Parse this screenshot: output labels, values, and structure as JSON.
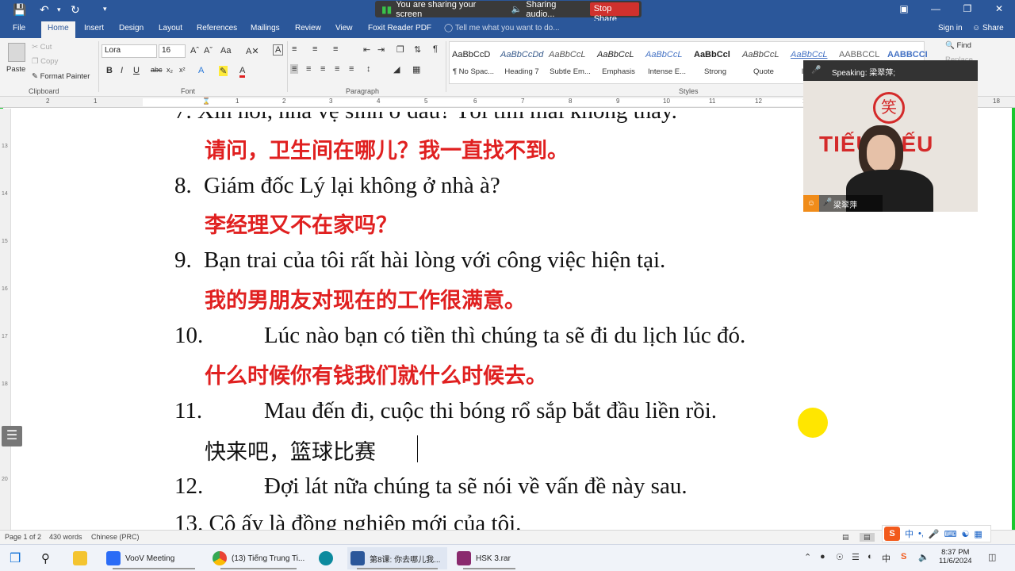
{
  "screen_share": {
    "status": "You are sharing your screen",
    "audio": "Sharing audio...",
    "stop": "Stop Share"
  },
  "ribbon_tabs": [
    "File",
    "Home",
    "Insert",
    "Design",
    "Layout",
    "References",
    "Mailings",
    "Review",
    "View",
    "Foxit Reader PDF"
  ],
  "tell_me": "Tell me what you want to do...",
  "sign_in": "Sign in",
  "share": "Share",
  "clipboard": {
    "paste": "Paste",
    "cut": "Cut",
    "copy": "Copy",
    "format_painter": "Format Painter",
    "label": "Clipboard"
  },
  "font": {
    "name": "Lora",
    "size": "16",
    "label": "Font"
  },
  "paragraph": {
    "label": "Paragraph"
  },
  "styles": {
    "label": "Styles",
    "items": [
      {
        "preview": "AaBbCcD",
        "name": "¶ No Spac..."
      },
      {
        "preview": "AaBbCcDd",
        "name": "Heading 7"
      },
      {
        "preview": "AaBbCcL",
        "name": "Subtle Em..."
      },
      {
        "preview": "AaBbCcL",
        "name": "Emphasis"
      },
      {
        "preview": "AaBbCcL",
        "name": "Intense E..."
      },
      {
        "preview": "AaBbCcl",
        "name": "Strong"
      },
      {
        "preview": "AaBbCcL",
        "name": "Quote"
      },
      {
        "preview": "AaBbCcL",
        "name": "Inter..."
      },
      {
        "preview": "AABBCCL",
        "name": ""
      },
      {
        "preview": "AABBCCI",
        "name": ""
      }
    ]
  },
  "editing": {
    "find": "Find",
    "replace": "Replace"
  },
  "ruler_ticks": [
    "2",
    "1",
    "1",
    "2",
    "3",
    "4",
    "5",
    "6",
    "7",
    "8",
    "9",
    "10",
    "11",
    "12",
    "13",
    "18"
  ],
  "vruler_ticks": [
    "13",
    "14",
    "15",
    "16",
    "17",
    "18",
    "19",
    "20"
  ],
  "document": {
    "top_partial": "7.  Xin hỏi, nhà vệ sinh ở đâu? Tôi tìm mãi không thấy.",
    "lines": [
      {
        "num": "",
        "text": "",
        "cn": "请问，卫生间在哪儿？我一直找不到。"
      },
      {
        "num": "8.",
        "text": "Giám đốc Lý lại không ở nhà à?",
        "cn": "李经理又不在家吗？"
      },
      {
        "num": "9.",
        "text": "Bạn trai của tôi rất hài lòng với công việc hiện tại.",
        "cn": "我的男朋友对现在的工作很满意。"
      },
      {
        "num": "10.",
        "text": "Lúc nào bạn có tiền thì chúng ta sẽ đi du lịch lúc đó.",
        "cn": "什么时候你有钱我们就什么时候去。"
      },
      {
        "num": "11.",
        "text": "Mau đến đi, cuộc thi bóng rổ sắp bắt đầu liền rồi.",
        "cn": "快来吧，篮球比赛"
      },
      {
        "num": "12.",
        "text": "Đợi lát nữa chúng ta sẽ nói về vấn đề này sau.",
        "cn": ""
      }
    ],
    "bottom_partial": "13.       Cô ấy là đồng nghiệp mới của tôi."
  },
  "video": {
    "speaking": "Speaking: 梁翠萍;",
    "name": "梁翠萍",
    "banner": "TIẾU TIẾU"
  },
  "status": {
    "page": "Page 1 of 2",
    "words": "430 words",
    "lang": "Chinese (PRC)"
  },
  "taskbar": {
    "apps": [
      "VooV Meeting",
      "(13) Tiếng Trung Ti...",
      "第8课: 你去哪儿我...",
      "HSK 3.rar"
    ],
    "time": "8:37 PM",
    "date": "11/6/2024"
  },
  "colors": {
    "word_blue": "#2b579a",
    "cn_red": "#e02020",
    "share_green": "#19c82e",
    "pointer": "#ffe600"
  }
}
